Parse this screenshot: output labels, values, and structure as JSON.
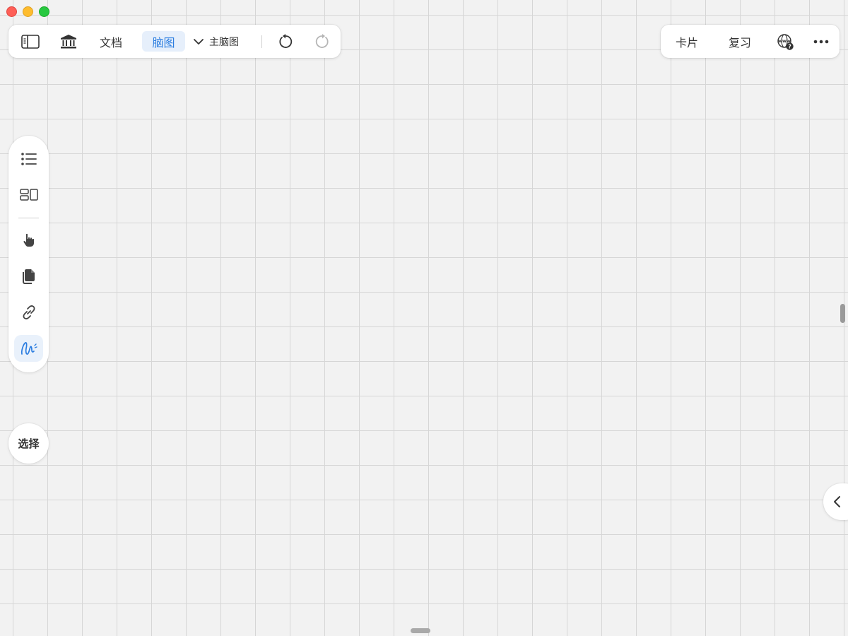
{
  "window": {
    "controls": [
      "close",
      "minimize",
      "zoom"
    ]
  },
  "toolbar_left": {
    "sidebar_toggle_icon": "sidebar-icon",
    "library_icon": "library-icon",
    "doc_tab": "文档",
    "mindmap_tab": "脑图",
    "active_tab": "脑图",
    "map_selector_icon": "chevron-down-icon",
    "map_selector": "主脑图",
    "undo_icon": "undo-icon",
    "redo_icon": "redo-icon"
  },
  "toolbar_right": {
    "cards": "卡片",
    "review": "复习",
    "web_help_icon": "web-help-icon",
    "more_icon": "more-icon"
  },
  "side_tools": {
    "items": [
      {
        "name": "outline",
        "icon": "list-icon"
      },
      {
        "name": "layout",
        "icon": "layout-icon"
      },
      {
        "name": "hand",
        "icon": "hand-pointer-icon"
      },
      {
        "name": "copy",
        "icon": "copy-icon"
      },
      {
        "name": "link",
        "icon": "link-icon"
      },
      {
        "name": "draw",
        "icon": "freehand-draw-icon",
        "active": true
      }
    ]
  },
  "select_button": "选择",
  "collapse_right_icon": "chevron-left-icon",
  "colors": {
    "accent": "#2b7de0",
    "accent_bg": "#e6effb",
    "canvas_bg": "#f2f2f2",
    "grid_line": "#d6d6d6"
  }
}
